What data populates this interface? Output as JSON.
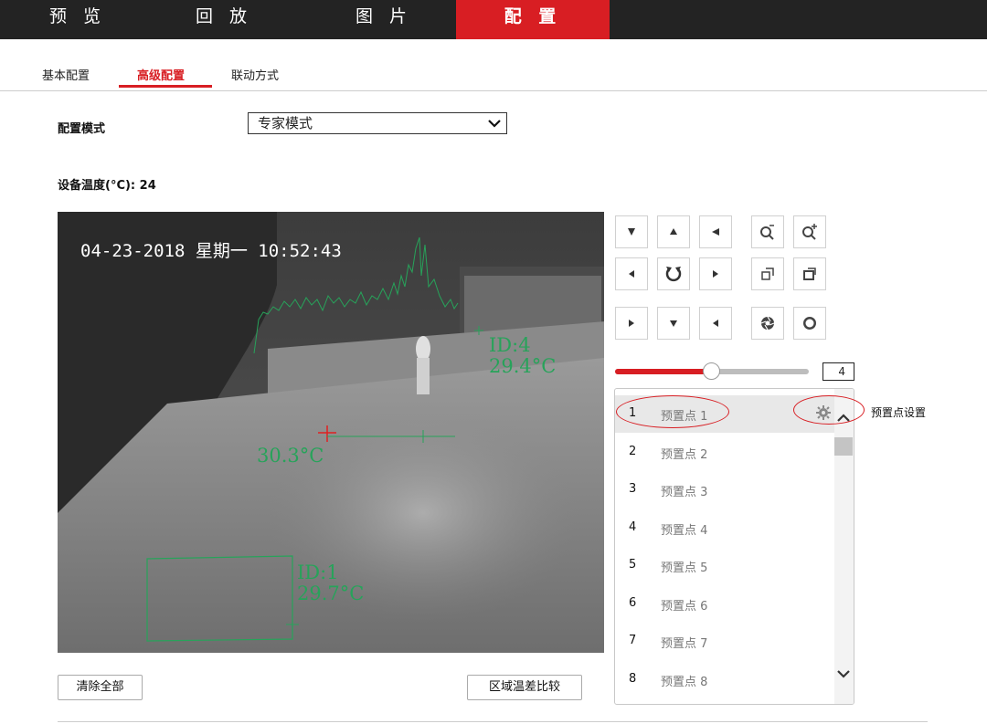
{
  "topnav": {
    "items": [
      "预 览",
      "回 放",
      "图 片",
      "配 置"
    ],
    "active_index": 3
  },
  "subtabs": {
    "items": [
      "基本配置",
      "高级配置",
      "联动方式"
    ],
    "active_index": 1
  },
  "config_mode": {
    "label": "配置模式",
    "value": "专家模式"
  },
  "device_temp": {
    "text": "设备温度(°C): 24"
  },
  "video": {
    "osd_time": "04-23-2018 星期一 10:52:43",
    "measurements": [
      {
        "id_label": "ID:4",
        "temp": "29.4°C"
      },
      {
        "id_label": "",
        "temp": "30.3°C"
      },
      {
        "id_label": "ID:1",
        "temp": "29.7°C"
      }
    ]
  },
  "ptz": {
    "buttons": [
      "arrow-up-left",
      "arrow-up",
      "arrow-up-right",
      "zoom-out",
      "zoom-in",
      "arrow-left",
      "auto-rotate",
      "arrow-right",
      "focus-near",
      "focus-far",
      "arrow-down-left",
      "arrow-down",
      "arrow-down-right",
      "iris-close",
      "iris-open"
    ],
    "speed_value": "4",
    "speed_fraction": 0.5
  },
  "presets": {
    "items": [
      {
        "num": "1",
        "name": "预置点 1"
      },
      {
        "num": "2",
        "name": "预置点 2"
      },
      {
        "num": "3",
        "name": "预置点 3"
      },
      {
        "num": "4",
        "name": "预置点 4"
      },
      {
        "num": "5",
        "name": "预置点 5"
      },
      {
        "num": "6",
        "name": "预置点 6"
      },
      {
        "num": "7",
        "name": "预置点 7"
      },
      {
        "num": "8",
        "name": "预置点 8"
      }
    ],
    "selected_index": 0,
    "settings_label": "预置点设置"
  },
  "buttons": {
    "clear_all": "清除全部",
    "region_compare": "区域温差比较"
  },
  "colors": {
    "accent": "#d81e23",
    "nav_bg": "#232323",
    "overlay_green": "#27a35a"
  }
}
